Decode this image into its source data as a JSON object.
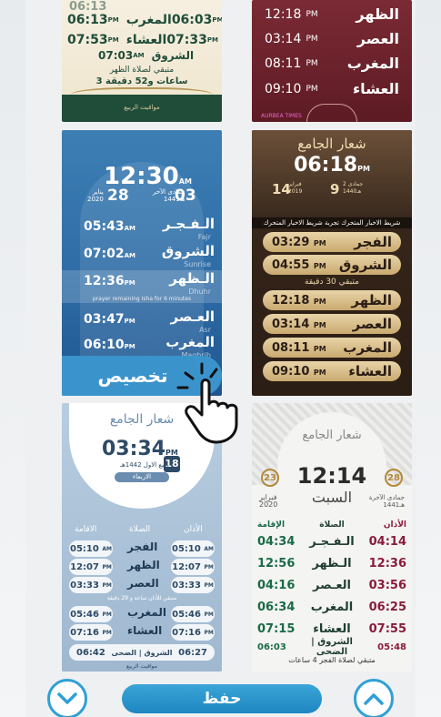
{
  "colors": {
    "accent": "#2fa0d6",
    "save_button": "#1f86c0"
  },
  "card_green": {
    "header_partial": "06:13",
    "rows": [
      {
        "t1": "06:13",
        "am1": "PM",
        "name": "المغرب",
        "t2": "06:03",
        "am2": "PM"
      },
      {
        "t1": "07:53",
        "am1": "PM",
        "name": "العشاء",
        "t2": "07:33",
        "am2": "PM"
      }
    ],
    "sunrise_label": "الشروق",
    "sunrise_time": "07:03",
    "sunrise_ampm": "AM",
    "countdown_line1": "متبقي لصلاة الظهر",
    "countdown_line2": "3 ساعات و52 دقيقة",
    "footer": "مواقيت الربيع"
  },
  "card_maroon": {
    "rows": [
      {
        "time": "12:18",
        "ampm": "PM",
        "name": "الظهر"
      },
      {
        "time": "03:14",
        "ampm": "PM",
        "name": "العصر"
      },
      {
        "time": "08:11",
        "ampm": "PM",
        "name": "المغرب"
      },
      {
        "time": "09:10",
        "ampm": "PM",
        "name": "العشاء"
      }
    ],
    "footer": "AURBEA TIMES"
  },
  "card_blue": {
    "clock": "12:30",
    "clock_ampm": "AM",
    "greg_day": "28",
    "greg_month": "يناير",
    "greg_year": "2020",
    "hijri_day": "03",
    "hijri_month": "جمادى الآخر",
    "hijri_year": "1441هـ",
    "rows": [
      {
        "time": "05:43",
        "ampm": "AM",
        "name": "الـفـجـر",
        "sub": "Fajr"
      },
      {
        "time": "07:02",
        "ampm": "AM",
        "name": "الشروق",
        "sub": "Sunrise"
      },
      {
        "time": "12:36",
        "ampm": "PM",
        "name": "الـظهر",
        "sub": "Dhuhr"
      },
      {
        "time": "03:47",
        "ampm": "PM",
        "name": "العـصر",
        "sub": "Asr"
      },
      {
        "time": "06:10",
        "ampm": "PM",
        "name": "المغرب",
        "sub": "Maghrib"
      }
    ],
    "remaining": "prayer remaining Isha for 6 minutes",
    "customize_label": "تخصيص"
  },
  "card_brown": {
    "logo": "شعار الجامع",
    "clock": "06:18",
    "clock_ampm": "PM",
    "day_left": "9",
    "month_left": "جمادى 2",
    "year_left": "1440هـ",
    "day_right": "14",
    "month_right": "فبراير",
    "year_right": "2019",
    "ticker": "شريط الاخبار المتحرك تجربة شريط الاخبار المتحرك",
    "rows": [
      {
        "time": "03:29",
        "ampm": "PM",
        "name": "الفجر"
      },
      {
        "time": "04:55",
        "ampm": "PM",
        "name": "الشروق"
      },
      {
        "time": "12:18",
        "ampm": "PM",
        "name": "الظهر"
      },
      {
        "time": "03:14",
        "ampm": "PM",
        "name": "العصر"
      },
      {
        "time": "08:11",
        "ampm": "PM",
        "name": "المغرب"
      },
      {
        "time": "09:10",
        "ampm": "PM",
        "name": "العشاء"
      }
    ],
    "countdown": "متبقي 30 دقيقة"
  },
  "card_lightblue": {
    "logo": "شعار الجامع",
    "clock": "03:34",
    "clock_ampm": "PM",
    "day": "18",
    "hijri": "ربيع الاول 1442هـ",
    "weekday": "الاربعاء",
    "headers": {
      "iqama": "الاقامة",
      "prayer": "الصلاة",
      "adhan": "الأذان"
    },
    "rows": [
      {
        "iqama": "05:10",
        "iqama_ampm": "AM",
        "name": "الفجر",
        "adhan": "05:10",
        "adhan_ampm": "AM"
      },
      {
        "iqama": "12:07",
        "iqama_ampm": "PM",
        "name": "الظهر",
        "adhan": "12:07",
        "adhan_ampm": "PM"
      },
      {
        "iqama": "03:33",
        "iqama_ampm": "PM",
        "name": "العصر",
        "adhan": "03:33",
        "adhan_ampm": "PM"
      },
      {
        "iqama": "05:46",
        "iqama_ampm": "PM",
        "name": "المغرب",
        "adhan": "05:46",
        "adhan_ampm": "PM"
      },
      {
        "iqama": "07:16",
        "iqama_ampm": "PM",
        "name": "العشاء",
        "adhan": "07:16",
        "adhan_ampm": "PM"
      }
    ],
    "remaining": "متبقي للأذان ساعة و 29 دقيقة",
    "footer_left": "06:42",
    "footer_mid": "الشروق | الضحى",
    "footer_right": "06:27",
    "brand": "مواقيت الربيع"
  },
  "card_white": {
    "logo": "شعار الجامع",
    "clock": "12:14",
    "day_left": "23",
    "day_right": "28",
    "weekday": "السبت",
    "month_left": "فبراير",
    "year_left": "2020",
    "month_right": "جمادى الآخرة",
    "year_right": "1441هـ",
    "headers": {
      "iqama": "الإقامة",
      "prayer": "الصلاة",
      "adhan": "الأذان"
    },
    "rows": [
      {
        "iqama": "04:34",
        "name": "الـفـجـر",
        "adhan": "04:14"
      },
      {
        "iqama": "12:56",
        "name": "الـظهر",
        "adhan": "12:36"
      },
      {
        "iqama": "04:16",
        "name": "العـصر",
        "adhan": "03:56"
      },
      {
        "iqama": "06:34",
        "name": "المغرب",
        "adhan": "06:25"
      },
      {
        "iqama": "07:15",
        "name": "العشاء",
        "adhan": "07:55"
      }
    ],
    "duha_left": "06:03",
    "duha_mid": "الشروق | الضحى",
    "duha_right": "05:48",
    "countdown": "متبقي لصلاة الفجر 4 ساعات"
  },
  "bottom": {
    "save_label": "حفظ",
    "down_icon": "chevron-down-icon",
    "up_icon": "chevron-up-icon"
  }
}
